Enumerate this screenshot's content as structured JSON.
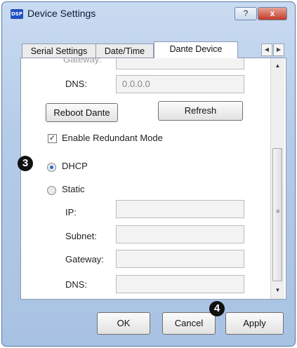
{
  "window": {
    "title": "Device Settings",
    "app_icon_text": "DSP",
    "help_label": "?",
    "close_label": "x"
  },
  "tabs": [
    {
      "label": "Serial Settings",
      "active": false
    },
    {
      "label": "Date/Time",
      "active": false
    },
    {
      "label": "Dante Device",
      "active": true
    }
  ],
  "panel": {
    "gateway_top_label": "Gateway:",
    "dns_top_label": "DNS:",
    "dns_top_value": "0.0.0.0",
    "reboot_label": "Reboot Dante",
    "refresh_label": "Refresh",
    "redundant_label": "Enable Redundant Mode",
    "redundant_checked": true,
    "dhcp_label": "DHCP",
    "static_label": "Static",
    "ip_label": "IP:",
    "subnet_label": "Subnet:",
    "gateway_label": "Gateway:",
    "dns_label": "DNS:",
    "ip_value": "",
    "subnet_value": "",
    "gateway_value": "",
    "dns_value": ""
  },
  "markers": {
    "m3": "3",
    "m4": "4"
  },
  "footer": {
    "ok_label": "OK",
    "cancel_label": "Cancel",
    "apply_label": "Apply"
  },
  "colors": {
    "title_bar": "#b4cbe8",
    "close_button": "#c43b27",
    "radio_selected": "#2a6bd6"
  }
}
